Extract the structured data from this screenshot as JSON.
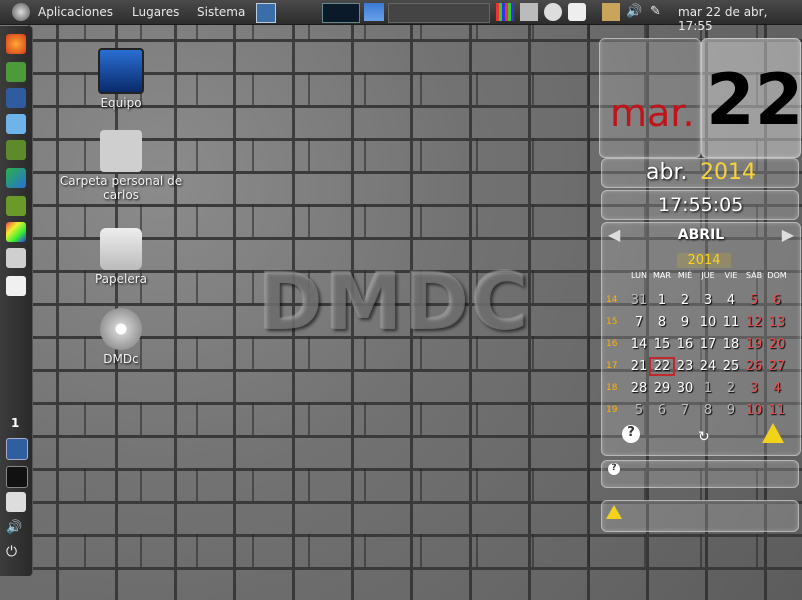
{
  "top_panel": {
    "menus": [
      "Aplicaciones",
      "Lugares",
      "Sistema"
    ],
    "clock": "mar 22 de abr, 17:55",
    "icons": [
      "ubuntu-logo-icon",
      "screenshot-icon",
      "system-monitor-icon",
      "workspace-switcher-icon",
      "color-picker-icon",
      "disk-mounter-icon",
      "disc-icon",
      "clock-applet-icon",
      "clipboard-icon",
      "volume-icon",
      "network-icon"
    ]
  },
  "dock": {
    "workspace_number": "1",
    "icons": [
      "firefox-icon",
      "gimp-icon",
      "inkscape-icon",
      "dropbox-icon",
      "owl-icon",
      "maps-icon",
      "download-icon",
      "paint-icon",
      "search-icon",
      "text-editor-icon",
      "workspace-icon",
      "terminal-icon",
      "home-icon",
      "volume-icon",
      "power-icon"
    ]
  },
  "desktop": {
    "icons": [
      {
        "label": "Equipo",
        "icon": "computer-icon"
      },
      {
        "label": "Carpeta personal de carlos",
        "icon": "home-folder-icon"
      },
      {
        "label": "Papelera",
        "icon": "trash-icon"
      },
      {
        "label": "DMDc",
        "icon": "dvd-icon"
      }
    ],
    "watermark": "DMDC"
  },
  "date_widget": {
    "weekday": "mar.",
    "day": "22",
    "month": "abr.",
    "year": "2014",
    "time": "17:55:05",
    "colors": {
      "weekday": "#c0141c",
      "year": "#f6d33a"
    }
  },
  "calendar": {
    "month": "ABRIL",
    "year": "2014",
    "days_of_week": [
      "LUN",
      "MAR",
      "MIÉ",
      "JUE",
      "VIE",
      "SÁB",
      "DOM"
    ],
    "weeks": [
      {
        "week": "14",
        "days": [
          "31",
          "1",
          "2",
          "3",
          "4",
          "5",
          "6"
        ]
      },
      {
        "week": "15",
        "days": [
          "7",
          "8",
          "9",
          "10",
          "11",
          "12",
          "13"
        ]
      },
      {
        "week": "16",
        "days": [
          "14",
          "15",
          "16",
          "17",
          "18",
          "19",
          "20"
        ]
      },
      {
        "week": "17",
        "days": [
          "21",
          "22",
          "23",
          "24",
          "25",
          "26",
          "27"
        ]
      },
      {
        "week": "18",
        "days": [
          "28",
          "29",
          "30",
          "1",
          "2",
          "3",
          "4"
        ]
      },
      {
        "week": "19",
        "days": [
          "5",
          "6",
          "7",
          "8",
          "9",
          "10",
          "11"
        ]
      }
    ],
    "today": "22"
  }
}
